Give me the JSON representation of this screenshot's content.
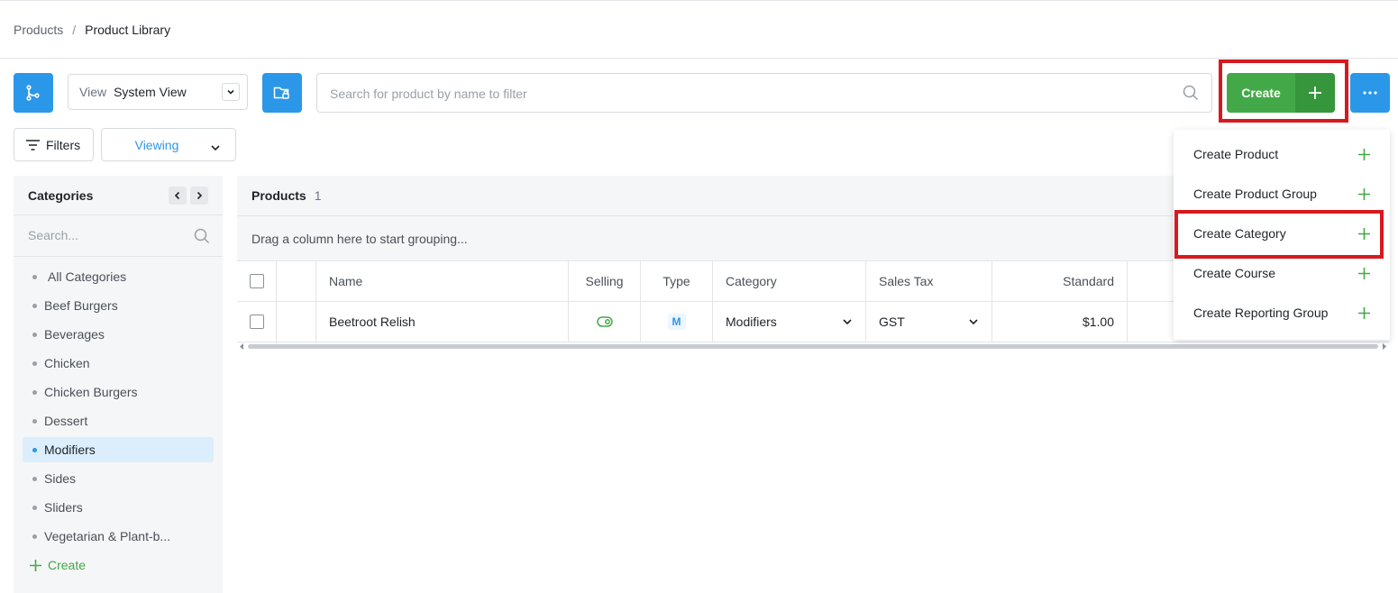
{
  "breadcrumb": {
    "parent": "Products",
    "separator": "/",
    "current": "Product Library"
  },
  "toolbar": {
    "view_label": "View",
    "view_value": "System View",
    "search_placeholder": "Search for product by name to filter",
    "create_label": "Create",
    "filters_label": "Filters",
    "viewing_label": "Viewing"
  },
  "colors": {
    "accent_blue": "#2b97e8",
    "create_green": "#43a948",
    "highlight_red": "#d7191f"
  },
  "sidebar": {
    "title": "Categories",
    "search_placeholder": "Search...",
    "items": [
      {
        "label": "All Categories"
      },
      {
        "label": "Beef Burgers"
      },
      {
        "label": "Beverages"
      },
      {
        "label": "Chicken"
      },
      {
        "label": "Chicken Burgers"
      },
      {
        "label": "Dessert"
      },
      {
        "label": "Modifiers",
        "active": true
      },
      {
        "label": "Sides"
      },
      {
        "label": "Sliders"
      },
      {
        "label": "Vegetarian & Plant-b..."
      }
    ],
    "create_label": "Create"
  },
  "grid": {
    "title": "Products",
    "count": "1",
    "group_hint": "Drag a column here to start grouping...",
    "columns": {
      "name": "Name",
      "selling": "Selling",
      "type": "Type",
      "category": "Category",
      "sales_tax": "Sales Tax",
      "standard": "Standard"
    },
    "rows": [
      {
        "name": "Beetroot Relish",
        "selling": true,
        "type": "M",
        "category": "Modifiers",
        "sales_tax": "GST",
        "standard": "$1.00"
      }
    ]
  },
  "create_menu": {
    "items": [
      {
        "label": "Create Product"
      },
      {
        "label": "Create Product Group"
      },
      {
        "label": "Create Category",
        "highlighted": true
      },
      {
        "label": "Create Course"
      },
      {
        "label": "Create Reporting Group"
      }
    ]
  }
}
